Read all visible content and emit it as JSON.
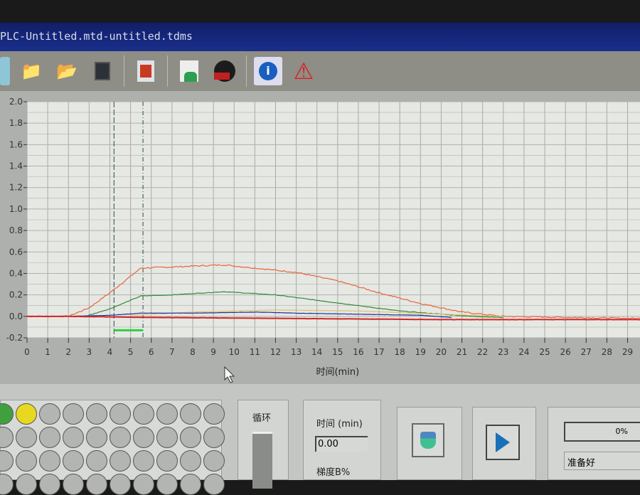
{
  "window": {
    "title": "PLC-Untitled.mtd-untitled.tdms"
  },
  "toolbar": {
    "icons": [
      "new-file-icon",
      "open-folder-icon",
      "open-method-icon",
      "save-icon",
      "report-icon",
      "instrument-icon",
      "record-icon",
      "info-icon",
      "warning-icon"
    ]
  },
  "chart_data": {
    "type": "line",
    "title": "",
    "xlabel": "时间(min)",
    "ylabel": "",
    "xlim": [
      0,
      30
    ],
    "ylim": [
      -0.2,
      2.0
    ],
    "xticks": [
      "0",
      "1",
      "2",
      "3",
      "4",
      "5",
      "6",
      "7",
      "8",
      "9",
      "10",
      "11",
      "12",
      "13",
      "14",
      "15",
      "16",
      "17",
      "18",
      "19",
      "20",
      "21",
      "22",
      "23",
      "24",
      "25",
      "26",
      "27",
      "28",
      "29",
      "3"
    ],
    "yticks": [
      "2.0",
      "1.8",
      "1.6",
      "1.4",
      "1.2",
      "1.0",
      "0.8",
      "0.6",
      "0.4",
      "0.2",
      "0.0",
      "-0.2"
    ],
    "grid": true,
    "markers": {
      "start_line_min": 4.2,
      "end_line_min": 5.6
    },
    "series": [
      {
        "name": "orange",
        "color": "#e8643c",
        "x": [
          0,
          2,
          3,
          4,
          5.5,
          7,
          9.5,
          11,
          13,
          15,
          17,
          19,
          21,
          23,
          26,
          29.9
        ],
        "y": [
          0,
          0,
          0.08,
          0.22,
          0.45,
          0.46,
          0.48,
          0.45,
          0.41,
          0.33,
          0.22,
          0.12,
          0.04,
          0.0,
          -0.01,
          -0.02
        ]
      },
      {
        "name": "green",
        "color": "#2f8a3a",
        "x": [
          0,
          2.8,
          4,
          5.5,
          7,
          9.5,
          12,
          14,
          16,
          18,
          20,
          21.5,
          23
        ],
        "y": [
          0,
          0,
          0.07,
          0.19,
          0.2,
          0.23,
          0.2,
          0.15,
          0.1,
          0.05,
          0.02,
          0,
          -0.01
        ]
      },
      {
        "name": "yellow",
        "color": "#e0c070",
        "x": [
          5,
          8,
          12,
          16,
          20,
          23
        ],
        "y": [
          0.01,
          0.04,
          0.06,
          0.05,
          0.02,
          0
        ]
      },
      {
        "name": "blue",
        "color": "#1c2fa0",
        "x": [
          0,
          2,
          4,
          5.5,
          8,
          11,
          13,
          16,
          19,
          20.5
        ],
        "y": [
          0,
          0,
          0.01,
          0.03,
          0.03,
          0.04,
          0.03,
          0.02,
          0.01,
          -0.01
        ]
      },
      {
        "name": "red",
        "color": "#d02828",
        "x": [
          0,
          2,
          6,
          13,
          20,
          29.9
        ],
        "y": [
          0,
          0,
          -0.01,
          -0.02,
          -0.03,
          -0.03
        ]
      }
    ]
  },
  "controls": {
    "cycle_label": "循环",
    "time_label": "时间 (min)",
    "time_value": "0.00",
    "gradient_label": "梯度B%",
    "progress_text": "0%",
    "progress": 0,
    "status": "准备好"
  }
}
